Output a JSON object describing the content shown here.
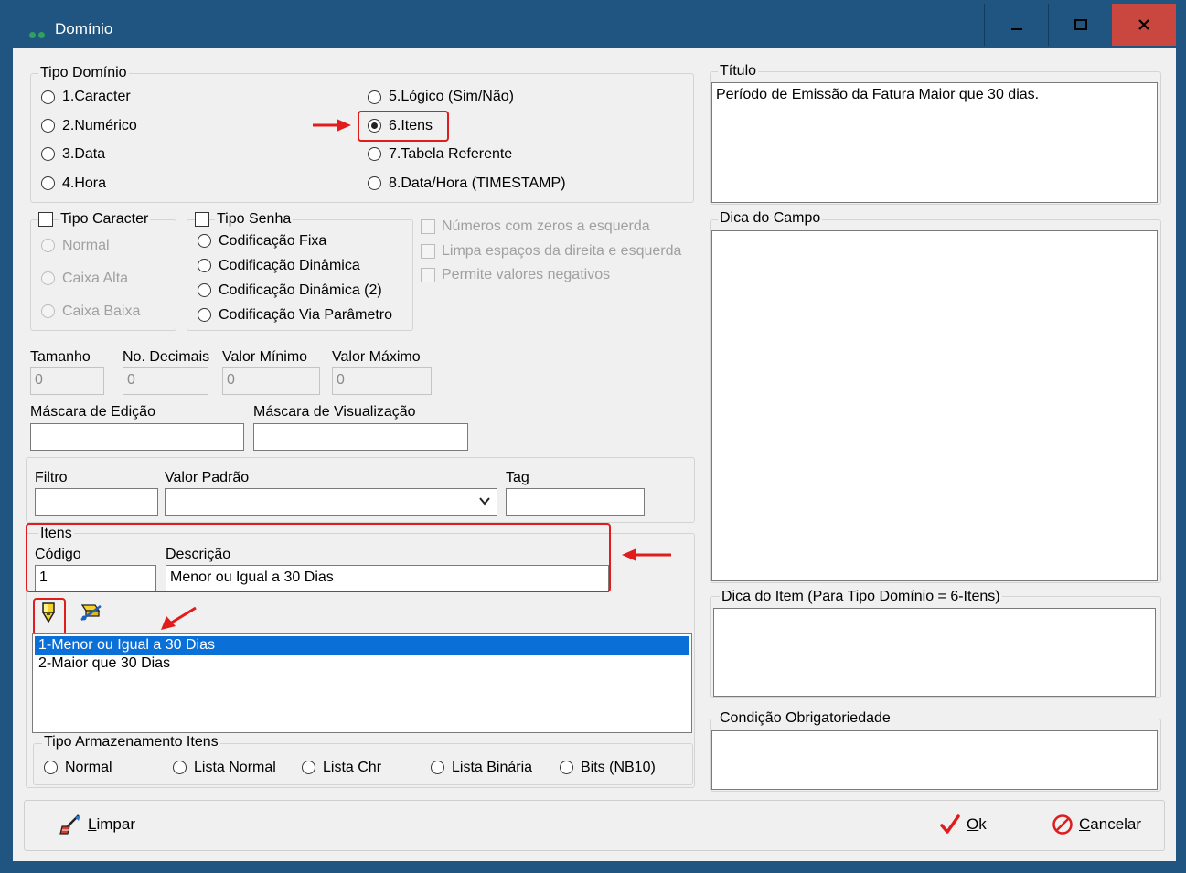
{
  "window": {
    "title": "Domínio",
    "minimize_label": "—",
    "maximize_label": "☐",
    "close_label": "✕"
  },
  "tipo_dominio": {
    "label": "Tipo Domínio",
    "options": [
      "1.Caracter",
      "2.Numérico",
      "3.Data",
      "4.Hora",
      "5.Lógico (Sim/Não)",
      "6.Itens",
      "7.Tabela Referente",
      "8.Data/Hora (TIMESTAMP)"
    ],
    "selected": "6.Itens"
  },
  "tipo_caracter": {
    "label": "Tipo Caracter",
    "options": [
      "Normal",
      "Caixa Alta",
      "Caixa Baixa"
    ]
  },
  "tipo_senha": {
    "label": "Tipo Senha",
    "options": [
      "Codificação Fixa",
      "Codificação Dinâmica",
      "Codificação Dinâmica (2)",
      "Codificação Via Parâmetro"
    ]
  },
  "flags": [
    "Números com zeros a esquerda",
    "Limpa espaços da direita e esquerda",
    "Permite valores negativos"
  ],
  "numeric": {
    "tamanho_label": "Tamanho",
    "tamanho_value": "0",
    "decimais_label": "No. Decimais",
    "decimais_value": "0",
    "minimo_label": "Valor Mínimo",
    "minimo_value": "0",
    "maximo_label": "Valor Máximo",
    "maximo_value": "0"
  },
  "mascaras": {
    "edicao_label": "Máscara de Edição",
    "visualizacao_label": "Máscara de Visualização"
  },
  "filtro": {
    "filtro_label": "Filtro",
    "padrao_label": "Valor Padrão",
    "tag_label": "Tag"
  },
  "itens": {
    "label": "Itens",
    "codigo_label": "Código",
    "codigo_value": "1",
    "descricao_label": "Descrição",
    "descricao_value": "Menor ou Igual a 30 Dias",
    "list": [
      "1-Menor ou Igual a 30 Dias",
      "2-Maior que 30 Dias"
    ],
    "selected_index": 0
  },
  "tipo_armazenamento": {
    "label": "Tipo Armazenamento Itens",
    "options": [
      "Normal",
      "Lista Normal",
      "Lista Chr",
      "Lista Binária",
      "Bits (NB10)"
    ]
  },
  "titulo": {
    "label": "Título",
    "value": "Período de Emissão da Fatura Maior que 30 dias."
  },
  "dica_campo": {
    "label": "Dica do Campo"
  },
  "dica_item": {
    "label": "Dica do Item (Para Tipo Domínio = 6-Itens)"
  },
  "condicao": {
    "label": "Condição Obrigatoriedade"
  },
  "buttons": {
    "limpar": "Limpar",
    "ok": "Ok",
    "cancelar": "Cancelar"
  },
  "colors": {
    "titlebar": "#1f5580",
    "close": "#c9473f",
    "selection": "#0a6fd6",
    "highlight": "#e01c1c"
  }
}
